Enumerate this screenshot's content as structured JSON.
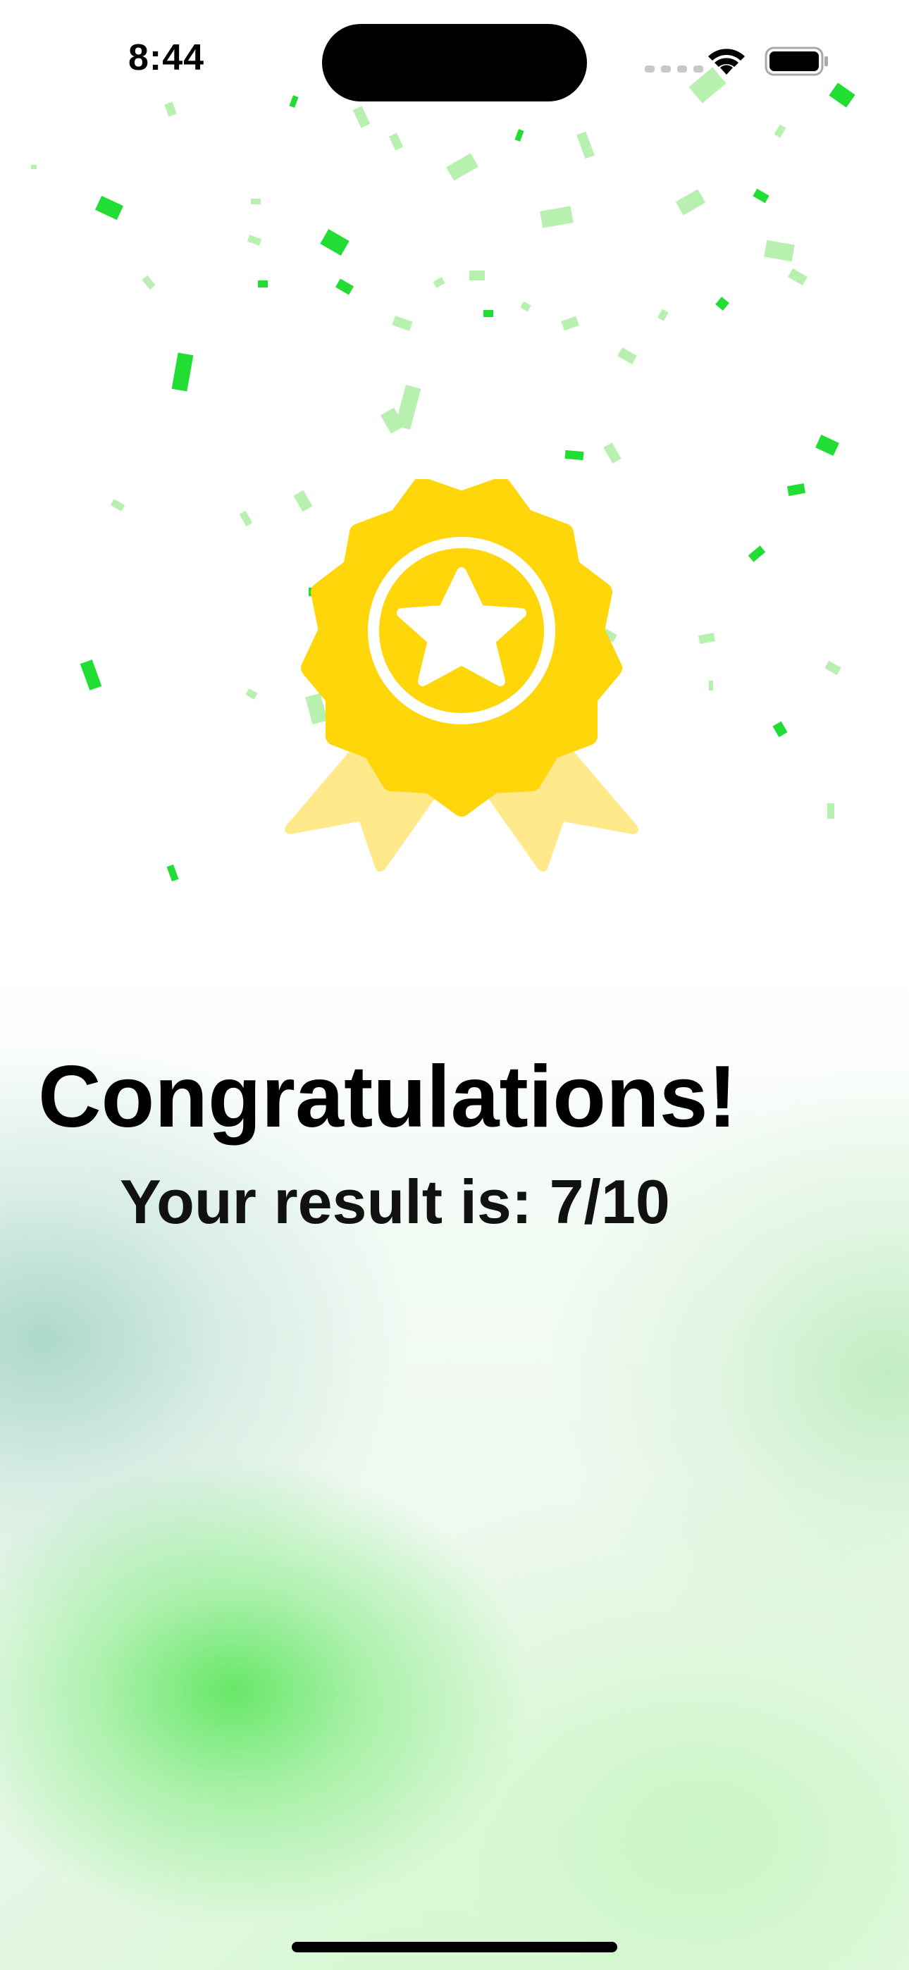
{
  "status_bar": {
    "time": "8:44"
  },
  "result_screen": {
    "title": "Congratulations!",
    "result_text": "Your result is: 7/10",
    "score": 7,
    "total": 10
  },
  "icons": {
    "badge": "award-ribbon-star-icon",
    "wifi": "wifi-icon",
    "battery": "battery-icon",
    "cellular": "cellular-signal-icon"
  },
  "colors": {
    "badge_gold": "#FFD60A",
    "ribbon_light": "#FFE98A",
    "confetti_bright": "#22DD33",
    "confetti_pale": "#B8F0B0",
    "text": "#000000"
  }
}
